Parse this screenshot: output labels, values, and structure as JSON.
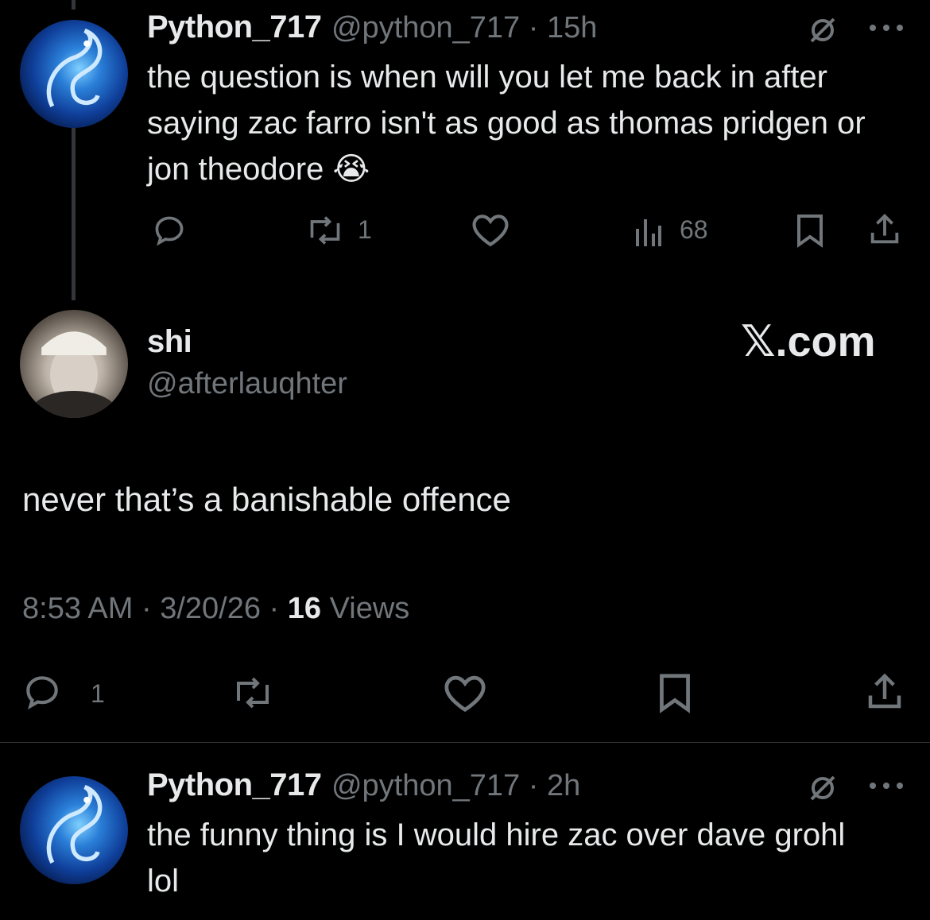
{
  "tweet1": {
    "name": "Python_717",
    "handle": "@python_717",
    "time": "15h",
    "text": "the question is when will you let me back in after saying zac farro isn't as good as thomas pridgen or jon theodore 😭",
    "retweets": "1",
    "views": "68"
  },
  "main": {
    "name": "shi",
    "handle": "@afterlauqhter",
    "watermark": "𝕏.com",
    "text": "never that’s a banishable offence",
    "timestamp": "8:53 AM · 3/20/26 · ",
    "views_count": "16",
    "views_label": " Views",
    "replies": "1"
  },
  "tweet2": {
    "name": "Python_717",
    "handle": "@python_717",
    "time": "2h",
    "text": "the funny thing is I would hire zac over dave grohl lol"
  },
  "separator": " · ",
  "icons": {
    "reply": "reply-icon",
    "retweet": "retweet-icon",
    "like": "heart-icon",
    "views": "views-icon",
    "bookmark": "bookmark-icon",
    "share": "share-icon",
    "more": "more-icon",
    "grok": "grok-icon"
  }
}
